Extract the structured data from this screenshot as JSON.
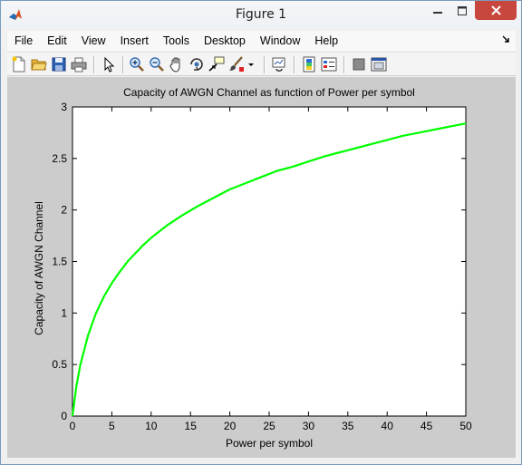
{
  "window": {
    "title": "Figure 1",
    "controls": {
      "minimize": "minimize",
      "maximize": "maximize",
      "close": "close"
    }
  },
  "menubar": {
    "items": [
      "File",
      "Edit",
      "View",
      "Insert",
      "Tools",
      "Desktop",
      "Window",
      "Help"
    ]
  },
  "toolbar": {
    "tools": [
      "new-figure-icon",
      "open-file-icon",
      "save-icon",
      "print-icon",
      "edit-plot-arrow-icon",
      "zoom-in-icon",
      "zoom-out-icon",
      "pan-hand-icon",
      "rotate-3d-icon",
      "data-cursor-icon",
      "brush-icon",
      "brush-dropdown-icon",
      "link-plot-icon",
      "insert-colorbar-icon",
      "insert-legend-icon",
      "hide-plot-tools-icon",
      "show-plot-tools-icon"
    ]
  },
  "colors": {
    "line": "#00ff00",
    "figure_background": "#cccccc",
    "axes_background": "#ffffff",
    "close_button": "#c7463d"
  },
  "chart_data": {
    "type": "line",
    "title": "Capacity of AWGN Channel as function of Power per symbol",
    "xlabel": "Power per symbol",
    "ylabel": "Capacity of AWGN Channel",
    "xlim": [
      0,
      50
    ],
    "ylim": [
      0,
      3
    ],
    "xticks": [
      "0",
      "5",
      "10",
      "15",
      "20",
      "25",
      "30",
      "35",
      "40",
      "45",
      "50"
    ],
    "yticks": [
      "0",
      "0.5",
      "1",
      "1.5",
      "2",
      "2.5",
      "3"
    ],
    "grid": false,
    "series": [
      {
        "x": [
          0,
          0.5,
          1,
          2,
          3,
          4,
          5,
          6,
          7,
          8,
          9,
          10,
          12,
          14,
          16,
          18,
          20,
          22,
          24,
          26,
          28,
          30,
          32,
          34,
          36,
          38,
          40,
          42,
          44,
          46,
          48,
          50
        ],
        "y": [
          0,
          0.29,
          0.5,
          0.79,
          1.0,
          1.16,
          1.29,
          1.4,
          1.5,
          1.58,
          1.66,
          1.73,
          1.85,
          1.95,
          2.04,
          2.12,
          2.2,
          2.26,
          2.32,
          2.38,
          2.42,
          2.47,
          2.52,
          2.56,
          2.6,
          2.64,
          2.68,
          2.72,
          2.75,
          2.78,
          2.81,
          2.84
        ]
      }
    ]
  }
}
